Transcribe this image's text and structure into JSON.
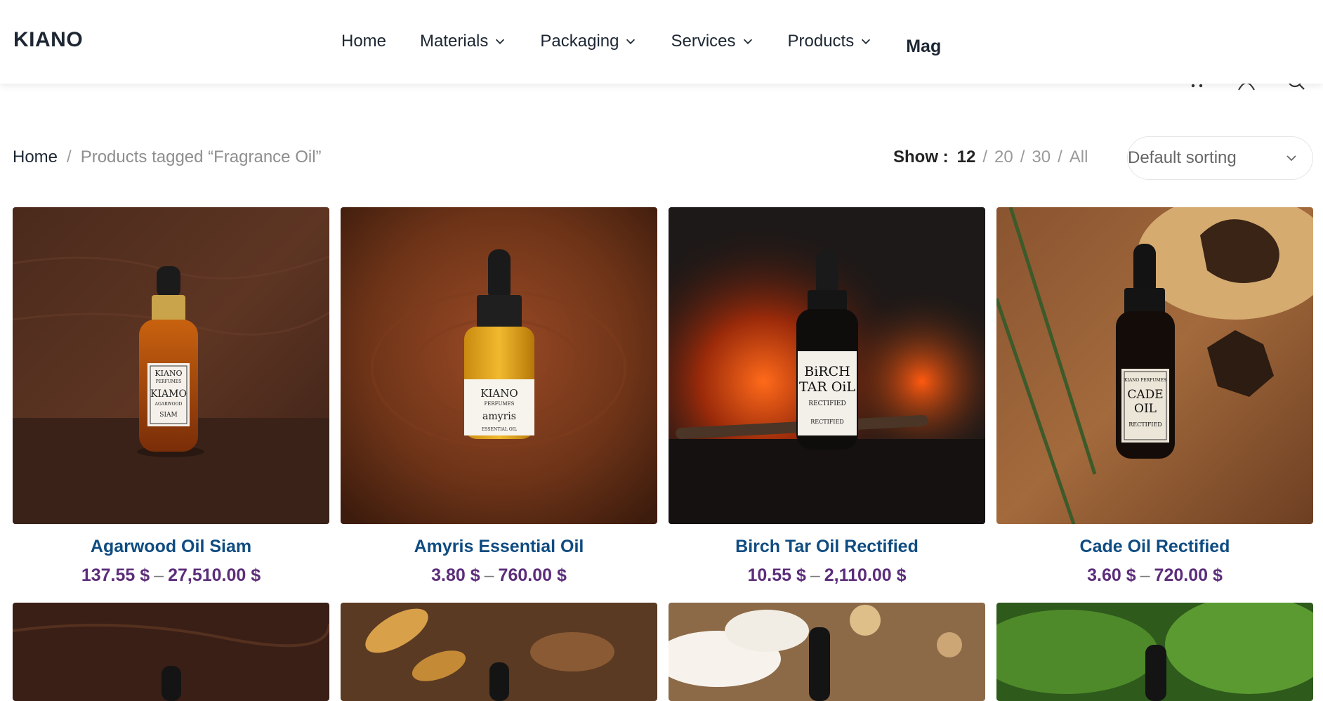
{
  "header": {
    "logo": "KIANO",
    "nav": [
      {
        "label": "Home",
        "dropdown": false
      },
      {
        "label": "Materials",
        "dropdown": true
      },
      {
        "label": "Packaging",
        "dropdown": true
      },
      {
        "label": "Services",
        "dropdown": true
      },
      {
        "label": "Products",
        "dropdown": true
      },
      {
        "label": "Mag",
        "dropdown": false
      }
    ]
  },
  "breadcrumb": {
    "home": "Home",
    "separator": "/",
    "current": "Products tagged “Fragrance Oil”"
  },
  "show": {
    "label": "Show :",
    "options": [
      "12",
      "20",
      "30",
      "All"
    ],
    "active": "12"
  },
  "sort": {
    "selected": "Default sorting"
  },
  "products": [
    {
      "name": "Agarwood Oil Siam",
      "price_min": "137.55 $",
      "price_max": "27,510.00 $",
      "label_lines": [
        "KIANO",
        "PERFUMES",
        "KIAMO",
        "AGARWOOD",
        "SIAM"
      ]
    },
    {
      "name": "Amyris Essential Oil",
      "price_min": "3.80 $",
      "price_max": "760.00 $",
      "label_lines": [
        "KIANO",
        "PERFUMES",
        "amyris",
        "ESSENTIAL OIL"
      ]
    },
    {
      "name": "Birch Tar Oil Rectified",
      "price_min": "10.55 $",
      "price_max": "2,110.00 $",
      "label_lines": [
        "BiRCH",
        "TAR OiL",
        "RECTIFIED",
        "RECTIFIED"
      ]
    },
    {
      "name": "Cade Oil Rectified",
      "price_min": "3.60 $",
      "price_max": "720.00 $",
      "label_lines": [
        "KIANO PERFUMES",
        "CADE",
        "OIL",
        "RECTIFIED"
      ]
    }
  ],
  "price_dash": "–",
  "colors": {
    "product_title": "#0f4c81",
    "price": "#5c2d7a",
    "nav_text": "#1d2733"
  }
}
